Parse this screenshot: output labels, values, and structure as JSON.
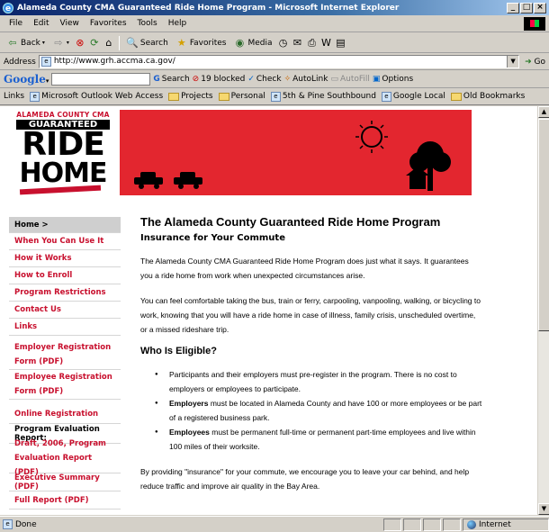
{
  "window": {
    "title": "Alameda County CMA Guaranteed Ride Home Program - Microsoft Internet Explorer",
    "buttons": [
      "_",
      "□",
      "×"
    ]
  },
  "menu": [
    "File",
    "Edit",
    "View",
    "Favorites",
    "Tools",
    "Help"
  ],
  "toolbar": {
    "back": "Back",
    "search": "Search",
    "favorites": "Favorites",
    "media": "Media"
  },
  "address": {
    "label": "Address",
    "url": "http://www.grh.accma.ca.gov/",
    "go": "Go"
  },
  "googlebar": {
    "logo": "Google",
    "search": "Search",
    "blocked": "19 blocked",
    "check": "Check",
    "autolink": "AutoLink",
    "autofill": "AutoFill",
    "options": "Options"
  },
  "links": {
    "label": "Links",
    "items": [
      "Microsoft Outlook Web Access",
      "Projects",
      "Personal",
      "5th & Pine Southbound",
      "Google Local",
      "Old Bookmarks"
    ]
  },
  "logo": {
    "line1": "ALAMEDA COUNTY CMA",
    "line2": "GUARANTEED",
    "line3": "RIDE",
    "line4": "HOME"
  },
  "sidebar": {
    "home": "Home >",
    "items": [
      "When You Can Use It",
      "How it Works",
      "How to Enroll",
      "Program Restrictions",
      "Contact Us",
      "Links"
    ],
    "registration": [
      "Employer Registration Form (PDF)",
      "Employee Registration Form (PDF)"
    ],
    "online": "Online Registration",
    "report_heading": "Program Evaluation Report:",
    "reports": [
      "Draft, 2006, Program Evaluation Report (PDF)",
      "Executive Summary (PDF)",
      "Full Report (PDF)"
    ]
  },
  "content": {
    "title": "The Alameda County Guaranteed Ride Home Program",
    "subtitle": "Insurance for Your Commute",
    "p1": "The Alameda County CMA Guaranteed Ride Home Program does just what it says. It guarantees you a ride home from work when unexpected circumstances arise.",
    "p2": "You can feel comfortable taking the bus, train or ferry, carpooling, vanpooling, walking, or bicycling to work, knowing that you will have a ride home in case of illness, family crisis, unscheduled overtime, or a missed rideshare trip.",
    "eligible_heading": "Who Is Eligible?",
    "bullet1": "Participants and their employers must pre-register in the program. There is no cost to employers or employees to participate.",
    "bullet2_bold": "Employers",
    "bullet2_rest": " must be located in Alameda County and have 100 or more employees or be part of a registered business park.",
    "bullet3_bold": "Employees",
    "bullet3_rest": " must be permanent full-time or permanent part-time employees and live within 100 miles of their worksite.",
    "p3": "By providing \"insurance\" for your commute, we encourage you to leave your car behind, and help reduce traffic and improve air quality in the Bay Area."
  },
  "status": {
    "text": "Done",
    "zone": "Internet"
  }
}
